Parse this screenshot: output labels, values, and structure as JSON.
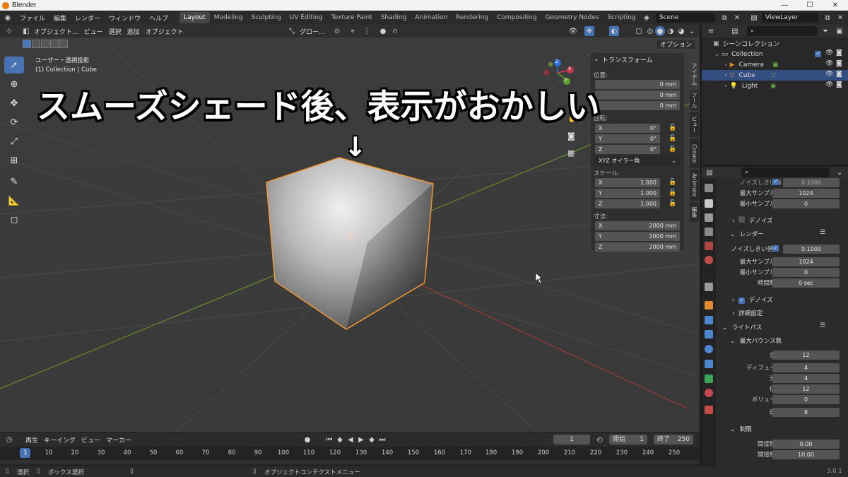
{
  "window": {
    "title": "Blender"
  },
  "menus": [
    "ファイル",
    "編集",
    "レンダー",
    "ウィンドウ",
    "ヘルプ"
  ],
  "workspaces": [
    {
      "label": "Layout",
      "active": true
    },
    {
      "label": "Modeling"
    },
    {
      "label": "Sculpting"
    },
    {
      "label": "UV Editing"
    },
    {
      "label": "Texture Paint"
    },
    {
      "label": "Shading"
    },
    {
      "label": "Animation"
    },
    {
      "label": "Rendering"
    },
    {
      "label": "Compositing"
    },
    {
      "label": "Geometry Nodes"
    },
    {
      "label": "Scripting"
    }
  ],
  "add_tab": "+",
  "scene": {
    "label": "Scene",
    "viewlayer": "ViewLayer"
  },
  "viewport_header": {
    "mode": "オブジェクト...",
    "menus": [
      "ビュー",
      "選択",
      "追加",
      "オブジェクト"
    ],
    "transform": "グロー...",
    "options": "オプション"
  },
  "viewport": {
    "view_name": "ユーザー・透視投影",
    "collection_info": "(1) Collection | Cube",
    "annotation": "スムーズシェード後、表示がおかしい",
    "arrow": "↓"
  },
  "gizmo": {
    "x": "X",
    "y": "Y",
    "z": "Z"
  },
  "npanel": {
    "title": "トランスフォーム",
    "location_label": "位置:",
    "location": [
      "0 mm",
      "0 mm",
      "0 mm"
    ],
    "rotation_label": "回転:",
    "rotation": [
      {
        "axis": "X",
        "value": "0°"
      },
      {
        "axis": "Y",
        "value": "0°"
      },
      {
        "axis": "Z",
        "value": "0°"
      }
    ],
    "rotation_mode": "XYZ オイラー角",
    "scale_label": "スケール:",
    "scale": [
      {
        "axis": "X",
        "value": "1.000"
      },
      {
        "axis": "Y",
        "value": "1.000"
      },
      {
        "axis": "Z",
        "value": "1.000"
      }
    ],
    "dimensions_label": "寸法:",
    "dimensions": [
      {
        "axis": "X",
        "value": "2000 mm"
      },
      {
        "axis": "Y",
        "value": "2000 mm"
      },
      {
        "axis": "Z",
        "value": "2000 mm"
      }
    ],
    "tabs": [
      "アイテム",
      "ツール",
      "ビュー",
      "Create",
      "Animate",
      "編集"
    ]
  },
  "outliner": {
    "root": "シーンコレクション",
    "collection": "Collection",
    "items": [
      {
        "label": "Camera",
        "selected": false,
        "color": "#d98a2f"
      },
      {
        "label": "Cube",
        "selected": true,
        "color": "#e89a40"
      },
      {
        "label": "Light",
        "selected": false,
        "color": "#d98a2f"
      }
    ]
  },
  "properties": {
    "top_partial": {
      "label": "ノイズしきい値",
      "value": "0.1000"
    },
    "top_rows": [
      {
        "label": "最大サンプル数",
        "value": "1024"
      },
      {
        "label": "最小サンプル数",
        "value": "0"
      }
    ],
    "denoise_viewport": "デノイズ",
    "render_section": "レンダー",
    "render_rows": [
      {
        "label": "ノイズしきい値",
        "value": "0.1000"
      },
      {
        "label": "最大サンプル数",
        "value": "1024"
      },
      {
        "label": "最小サンプル数",
        "value": "0"
      },
      {
        "label": "時間制限",
        "value": "0 sec"
      }
    ],
    "denoise_render": "デノイズ",
    "advanced": "詳細設定",
    "light_paths": "ライトパス",
    "max_bounces": "最大バウンス数",
    "bounce_rows": [
      {
        "label": "合計",
        "value": "12"
      },
      {
        "label": "ディフューズ",
        "value": "4"
      },
      {
        "label": "光沢",
        "value": "4"
      },
      {
        "label": "伝播",
        "value": "12"
      },
      {
        "label": "ボリューム",
        "value": "0"
      },
      {
        "label": "透過",
        "value": "8"
      }
    ],
    "clamping": "制限",
    "clamp_rows": [
      {
        "label": "間接照明",
        "value": "0.00"
      },
      {
        "label": "間接照明",
        "value": "10.00"
      }
    ]
  },
  "timeline": {
    "menus": [
      "再生",
      "キーイング",
      "ビュー",
      "マーカー"
    ],
    "current_frame": "1",
    "start_label": "開始",
    "start": "1",
    "end_label": "終了",
    "end": "250",
    "ticks": [
      "1",
      "10",
      "20",
      "30",
      "40",
      "50",
      "60",
      "70",
      "80",
      "90",
      "100",
      "110",
      "120",
      "130",
      "140",
      "150",
      "160",
      "170",
      "180",
      "190",
      "200",
      "210",
      "220",
      "230",
      "240",
      "250"
    ]
  },
  "status": {
    "select": "選択",
    "box_select": "ボックス選択",
    "context_menu": "オブジェクトコンテクストメニュー",
    "version": "3.0.1"
  }
}
